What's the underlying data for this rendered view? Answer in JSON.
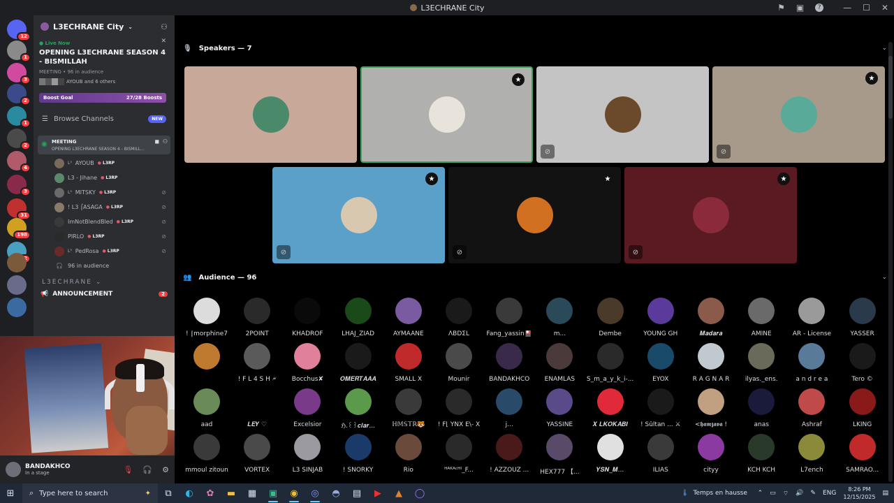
{
  "window": {
    "title": "L3ECHRANE City"
  },
  "guild_badges": [
    "12",
    "1",
    "3",
    "2",
    "1",
    "2",
    "4",
    "3",
    "31",
    "198",
    "52"
  ],
  "server": {
    "name": "L3ECHRANE City"
  },
  "live": {
    "status": "Live Now",
    "title": "OPENING L3ECHRANE SEASON 4 - BISMILLAH",
    "meta": "MEETING • 96 in audience",
    "others": "AYOUB and 6 others"
  },
  "boost": {
    "label": "Boost Goal",
    "count": "27/28 Boosts"
  },
  "browse": {
    "label": "Browse Channels",
    "badge": "NEW"
  },
  "stage_channel": {
    "name": "MEETING",
    "subtitle": "OPENING L3ECHRANE SEASON 4 - BISMILL..."
  },
  "voice_users": [
    {
      "name": "AYOUB",
      "prefix": "L³",
      "tag": "L3RP",
      "color": "#7a6a5a",
      "muted": false
    },
    {
      "name": "L3 - Jihane",
      "prefix": "",
      "tag": "L3RP",
      "color": "#5a8a6a",
      "muted": false
    },
    {
      "name": "MITSKY",
      "prefix": "L³",
      "tag": "L3RP",
      "color": "#6a6a6a",
      "muted": true
    },
    {
      "name": "! L3 ⌠ASAGA",
      "prefix": "",
      "tag": "L3RP",
      "color": "#8a7a6a",
      "muted": true
    },
    {
      "name": "ImNotBlendBled",
      "prefix": "",
      "tag": "L3RP",
      "color": "#3a3a3a",
      "muted": true
    },
    {
      "name": "PIRLO",
      "prefix": "",
      "tag": "L3RP",
      "color": "#2a2a2a",
      "muted": true
    },
    {
      "name": "PedRosa",
      "prefix": "L³",
      "tag": "L3RP",
      "color": "#6a2a2a",
      "muted": true
    }
  ],
  "audience_count_label": "96 in audience",
  "category": "L3ECHRANE",
  "announcement": {
    "label": "ANNOUNCEMENT",
    "badge": "2"
  },
  "user": {
    "name": "BANDAKHCO",
    "status": "In a stage"
  },
  "speakers": {
    "title": "Speakers — 7"
  },
  "audience": {
    "title": "Audience — 96"
  },
  "speaker_tiles": [
    {
      "bg": "#c8a898",
      "avatar": "#4a8a6a",
      "moderator": false,
      "muted": false,
      "selected": false
    },
    {
      "bg": "#b0b0ae",
      "avatar": "#e8e4dc",
      "moderator": true,
      "muted": false,
      "selected": true
    },
    {
      "bg": "#c4c4c4",
      "avatar": "#6a4a2a",
      "moderator": false,
      "muted": true,
      "selected": false
    },
    {
      "bg": "#a89a8a",
      "avatar": "#5aaa9a",
      "moderator": true,
      "muted": true,
      "selected": false
    },
    {
      "bg": "#5aa0c8",
      "avatar": "#d8c8b0",
      "moderator": true,
      "muted": true,
      "selected": false
    },
    {
      "bg": "#121212",
      "avatar": "#d07020",
      "moderator": true,
      "muted": true,
      "selected": false
    },
    {
      "bg": "#5a1a22",
      "avatar": "#8a2a3a",
      "moderator": true,
      "muted": true,
      "selected": false
    }
  ],
  "audience_members": [
    {
      "name": "! ⌠morphine7",
      "color": "#dcdcdc"
    },
    {
      "name": "2POINT",
      "color": "#2a2a2a"
    },
    {
      "name": "KHADROF",
      "color": "#0a0a0a"
    },
    {
      "name": "LHAJ_ZIAD",
      "color": "#1a4a1a"
    },
    {
      "name": "AYMAANE",
      "color": "#7a5aa0"
    },
    {
      "name": "ΛΒDΣL",
      "color": "#1a1a1a"
    },
    {
      "name": "Fang_yassin🎴",
      "color": "#3a3a3a"
    },
    {
      "name": "m...",
      "color": "#2a4a5a"
    },
    {
      "name": "Dembe",
      "color": "#4a3a2a"
    },
    {
      "name": "YOUNG GH",
      "color": "#5a3a9a"
    },
    {
      "name": "𝑴𝒂𝒅𝒂𝒓𝒂",
      "color": "#8a5a4a"
    },
    {
      "name": "AMINE",
      "color": "#6a6a6a"
    },
    {
      "name": "AR - License",
      "color": "#9a9a9a"
    },
    {
      "name": "YASSER",
      "color": "#2a3a4a"
    },
    {
      "name": "",
      "color": "#c07a30"
    },
    {
      "name": "! F L 4 S H 🗲",
      "color": "#5a5a5a"
    },
    {
      "name": "Bocchus✘",
      "color": "#e0809a"
    },
    {
      "name": "𝑶𝑴𝑬𝑹𝑻𝑨𝑨𝑨",
      "color": "#1a1a1a"
    },
    {
      "name": "SMALL X",
      "color": "#c02a2a"
    },
    {
      "name": "Mounir",
      "color": "#4a4a4a"
    },
    {
      "name": "BANDAKHCO",
      "color": "#3a2a4a"
    },
    {
      "name": "ENAMLAS",
      "color": "#4a3a3a"
    },
    {
      "name": "S_m_a_y_k_i-...",
      "color": "#2a2a2a"
    },
    {
      "name": "EYOX",
      "color": "#1a4a6a"
    },
    {
      "name": "R A G N A R",
      "color": "#c0c8d0"
    },
    {
      "name": "ilyas._ens.",
      "color": "#6a6a5a"
    },
    {
      "name": "a n d r e a",
      "color": "#5a7a9a"
    },
    {
      "name": "Tero ©",
      "color": "#1a1a1a"
    },
    {
      "name": "aad",
      "color": "#6a8a5a"
    },
    {
      "name": "𝑳𝑬𝒀 ♡",
      "color": "#000000"
    },
    {
      "name": "Excelsior",
      "color": "#7a3a8a"
    },
    {
      "name": "ℌ.꒰꒱𝒄𝒍𝒂𝒓...",
      "color": "#5a9a4a"
    },
    {
      "name": "ℍ𝕄𝕊𝕋ℝ🐯",
      "color": "#3a3a3a"
    },
    {
      "name": "! F⌊ YNX E\\- X",
      "color": "#2a2a2a"
    },
    {
      "name": "j...",
      "color": "#2a4a6a"
    },
    {
      "name": "YASSINE",
      "color": "#5a4a8a"
    },
    {
      "name": "𝑿 𝑳𝑲𝑶𝑲𝑨𝑩𝑰",
      "color": "#e02a3a"
    },
    {
      "name": "! Sûltan ... ⚔",
      "color": "#1a1a1a"
    },
    {
      "name": "<𝖍𝖆𝖒𝖟𝖆𝖛𝖆 !",
      "color": "#c0a080"
    },
    {
      "name": "anas",
      "color": "#1a1a3a"
    },
    {
      "name": "Ashraf",
      "color": "#c04a4a"
    },
    {
      "name": "LKING",
      "color": "#8a1a1a"
    },
    {
      "name": "mmoul zitoun",
      "color": "#3a3a3a"
    },
    {
      "name": "VORTEX",
      "color": "#4a4a4a"
    },
    {
      "name": "L3 SINJAB",
      "color": "#9a9aa0"
    },
    {
      "name": "! SNORKY",
      "color": "#1a3a6a"
    },
    {
      "name": "Rio",
      "color": "#6a4a3a"
    },
    {
      "name": "ᴴᴬᴷᴬᶜᴴᴵ_F...",
      "color": "#2a2a2a"
    },
    {
      "name": "! AZZOUZ ...",
      "color": "#4a1a1a"
    },
    {
      "name": "HEX777 【...",
      "color": "#5a4a6a"
    },
    {
      "name": "𝒀𝑺𝑵_𝑴...",
      "color": "#e0e0e0"
    },
    {
      "name": "ILIAS",
      "color": "#3a3a3a"
    },
    {
      "name": "cityy",
      "color": "#8a3aa0"
    },
    {
      "name": "KCH KCH",
      "color": "#2a3a2a"
    },
    {
      "name": "L7ench",
      "color": "#8a8a3a"
    },
    {
      "name": "SAMRAO...",
      "color": "#c02a2a"
    }
  ],
  "taskbar": {
    "search_placeholder": "Type here to search",
    "weather": "Temps en hausse",
    "lang": "ENG",
    "time": "8:26 PM",
    "date": "12/15/2025"
  }
}
